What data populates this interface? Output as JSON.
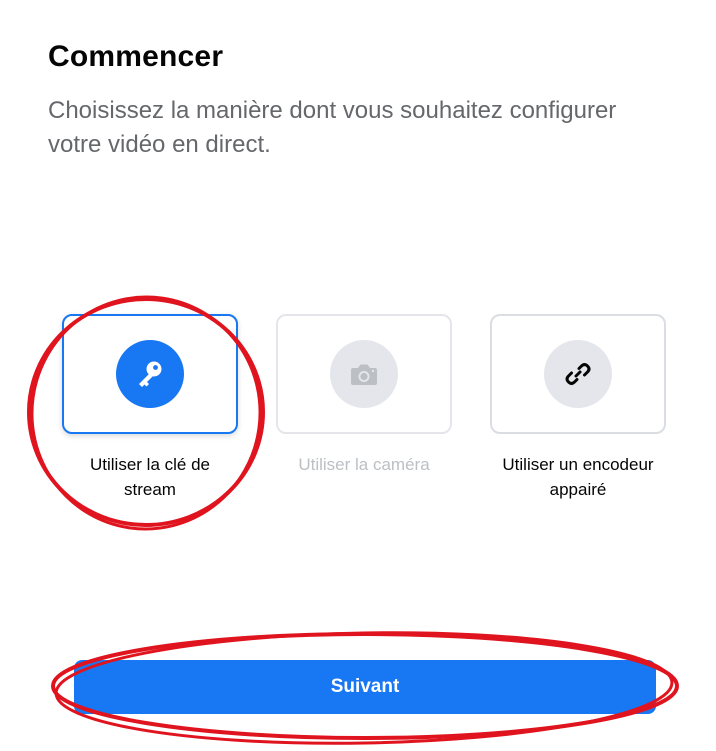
{
  "header": {
    "title": "Commencer",
    "subtitle": "Choisissez la manière dont vous souhaitez configurer votre vidéo en direct."
  },
  "options": [
    {
      "label": "Utiliser la clé de stream",
      "icon": "key-icon",
      "state": "selected"
    },
    {
      "label": "Utiliser la caméra",
      "icon": "camera-icon",
      "state": "disabled"
    },
    {
      "label": "Utiliser un encodeur appairé",
      "icon": "link-icon",
      "state": "normal"
    }
  ],
  "footer": {
    "next_label": "Suivant"
  },
  "colors": {
    "accent": "#1877f2",
    "annotation": "#e0141e",
    "disabled": "#bcc0c4"
  }
}
